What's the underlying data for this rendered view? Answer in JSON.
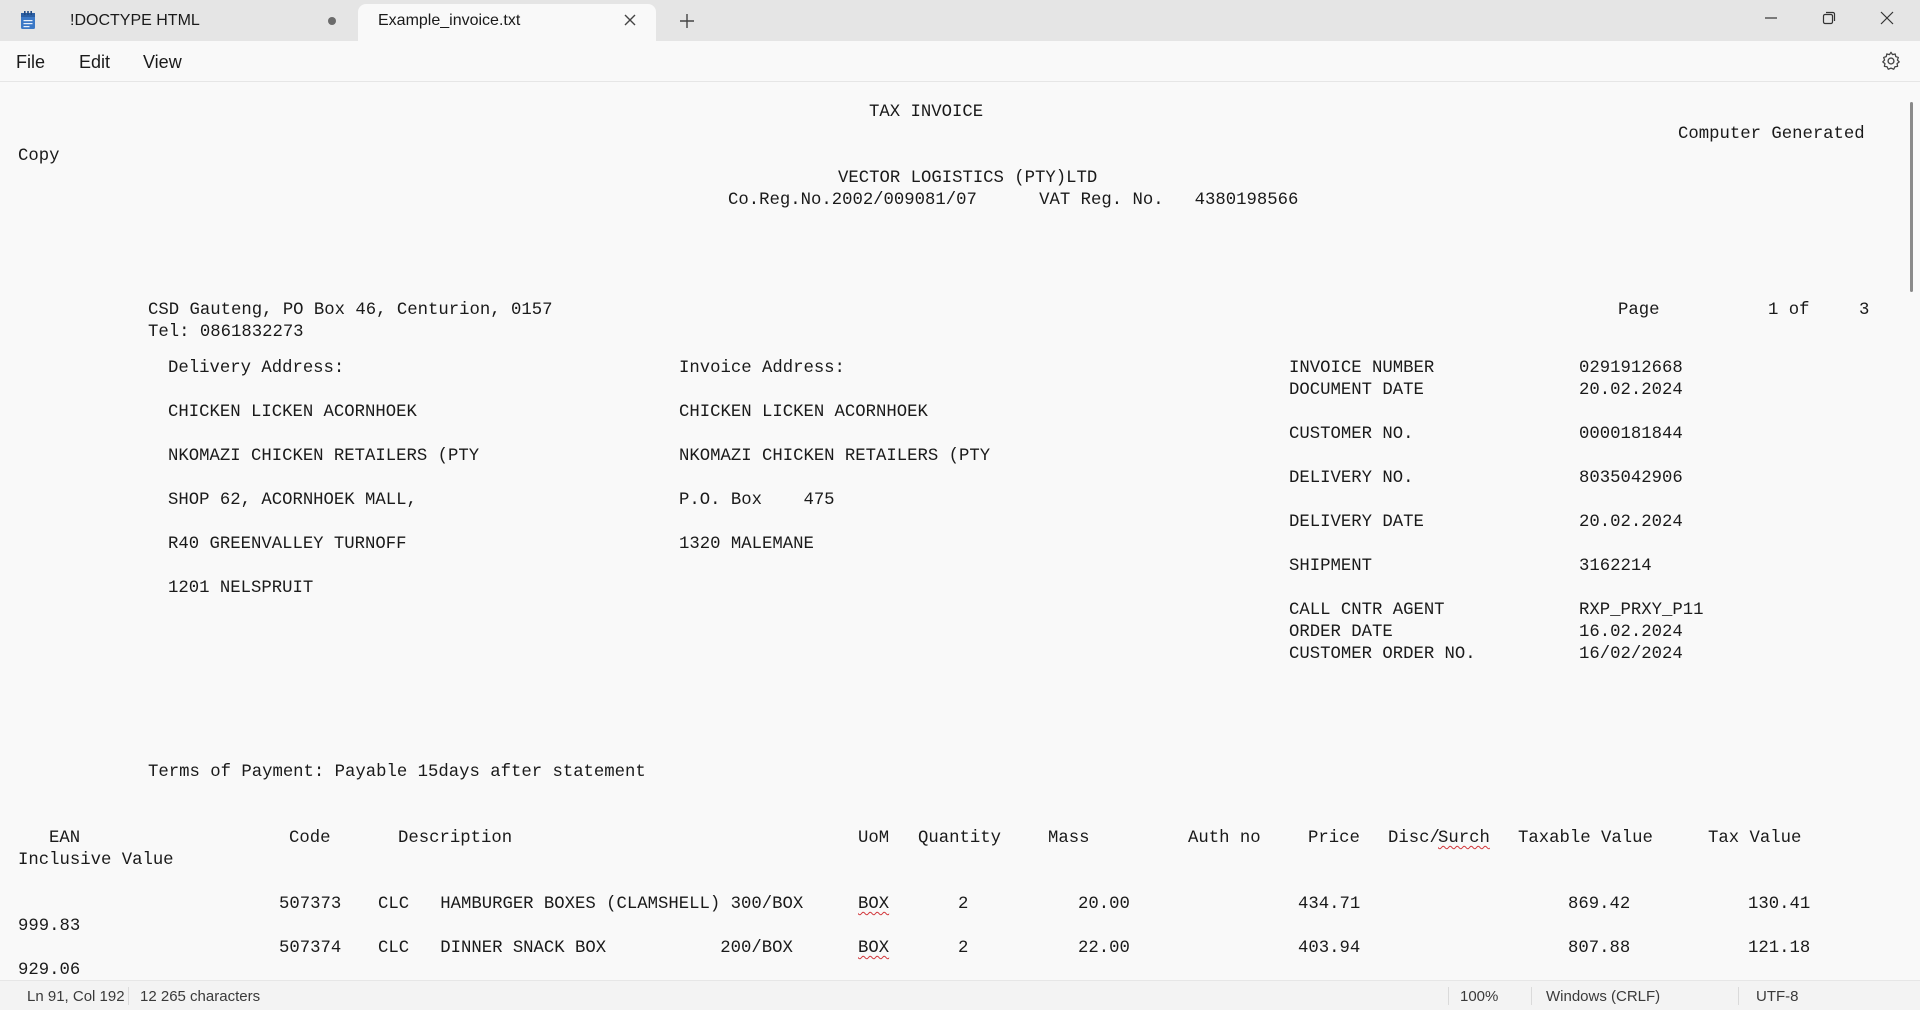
{
  "tabs": [
    {
      "label": "!DOCTYPE HTML",
      "modified": true
    },
    {
      "label": "Example_invoice.txt",
      "active": true
    }
  ],
  "menu": [
    "File",
    "Edit",
    "View"
  ],
  "icons": {
    "app": "notepad-icon",
    "settings": "gear-icon"
  },
  "document": {
    "title": "TAX INVOICE",
    "generated": "Computer Generated",
    "copy": "Copy",
    "company": "VECTOR LOGISTICS (PTY)LTD",
    "registration": "Co.Reg.No.2002/009081/07      VAT Reg. No.   4380198566",
    "sender_address": "CSD Gauteng, PO Box 46, Centurion, 0157",
    "sender_tel": "Tel: 0861832273",
    "page_label": "Page",
    "page_current": "1 of",
    "page_total": "3",
    "delivery_label": "Delivery Address:",
    "delivery_lines": [
      "CHICKEN LICKEN ACORNHOEK",
      "NKOMAZI CHICKEN RETAILERS (PTY",
      "SHOP 62, ACORNHOEK MALL,",
      "R40 GREENVALLEY TURNOFF",
      "1201 NELSPRUIT"
    ],
    "invoice_label": "Invoice Address:",
    "invoice_lines": [
      "CHICKEN LICKEN ACORNHOEK",
      "NKOMAZI CHICKEN RETAILERS (PTY",
      "P.O. Box    475",
      "1320 MALEMANE"
    ],
    "details": [
      {
        "label": "INVOICE NUMBER",
        "value": "0291912668"
      },
      {
        "label": "DOCUMENT DATE",
        "value": "20.02.2024"
      },
      {
        "label": "CUSTOMER NO.",
        "value": "0000181844"
      },
      {
        "label": "DELIVERY NO.",
        "value": "8035042906"
      },
      {
        "label": "DELIVERY DATE",
        "value": "20.02.2024"
      },
      {
        "label": "SHIPMENT",
        "value": "3162214"
      },
      {
        "label": "CALL CNTR AGENT",
        "value": "RXP_PRXY_P11"
      },
      {
        "label": "ORDER DATE",
        "value": "16.02.2024"
      },
      {
        "label": "CUSTOMER ORDER NO.",
        "value": "16/02/2024"
      }
    ],
    "terms": "Terms of Payment: Payable 15days after statement",
    "headers": {
      "ean": "EAN",
      "code": "Code",
      "description": "Description",
      "uom": "UoM",
      "quantity": "Quantity",
      "mass": "Mass",
      "auth": "Auth no",
      "price": "Price",
      "disc": "Disc/",
      "surch": "Surch",
      "taxable": "Taxable Value",
      "tax": "Tax Value",
      "inclusive": "Inclusive Value"
    },
    "items": [
      {
        "code": "507373",
        "desc": "CLC   HAMBURGER BOXES (CLAMSHELL) 300/BOX",
        "uom": "BOX",
        "qty": "2",
        "mass": "20.00",
        "price": "434.71",
        "taxable": "869.42",
        "tax": "130.41",
        "inclusive": "999.83"
      },
      {
        "code": "507374",
        "desc": "CLC   DINNER SNACK BOX           200/BOX",
        "uom": "BOX",
        "qty": "2",
        "mass": "22.00",
        "price": "403.94",
        "taxable": "807.88",
        "tax": "121.18",
        "inclusive": "929.06"
      }
    ]
  },
  "status": {
    "position": "Ln 91, Col 192",
    "characters": "12 265 characters",
    "zoom": "100%",
    "line_ending": "Windows (CRLF)",
    "encoding": "UTF-8"
  }
}
